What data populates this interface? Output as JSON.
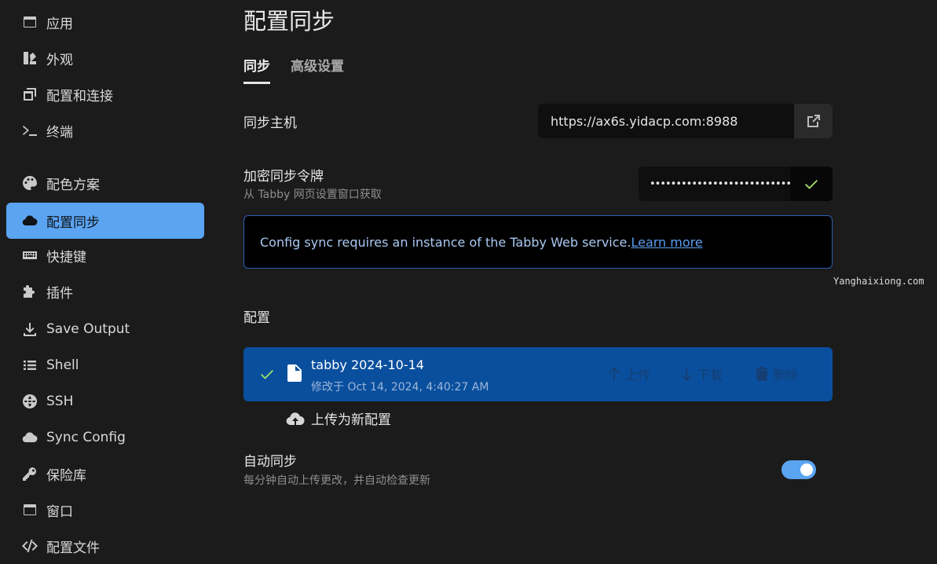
{
  "sidebar": {
    "items": [
      {
        "label": "应用",
        "icon": "window-icon"
      },
      {
        "label": "外观",
        "icon": "paint-swatch-icon"
      },
      {
        "label": "配置和连接",
        "icon": "copy-window-icon"
      },
      {
        "label": "终端",
        "icon": "terminal-icon"
      },
      {
        "label": "配色方案",
        "icon": "palette-icon"
      },
      {
        "label": "配置同步",
        "icon": "cloud-icon",
        "active": true
      },
      {
        "label": "快捷键",
        "icon": "keyboard-icon"
      },
      {
        "label": "插件",
        "icon": "puzzle-icon"
      },
      {
        "label": "Save Output",
        "icon": "download-icon"
      },
      {
        "label": "Shell",
        "icon": "list-icon"
      },
      {
        "label": "SSH",
        "icon": "globe-icon"
      },
      {
        "label": "Sync Config",
        "icon": "cloud-icon"
      },
      {
        "label": "保险库",
        "icon": "key-icon"
      },
      {
        "label": "窗口",
        "icon": "window-icon"
      },
      {
        "label": "配置文件",
        "icon": "code-icon"
      }
    ]
  },
  "page": {
    "title": "配置同步",
    "tabs": [
      {
        "label": "同步"
      },
      {
        "label": "高级设置"
      }
    ]
  },
  "host": {
    "label": "同步主机",
    "value": "https://ax6s.yidacp.com:8988"
  },
  "token": {
    "label": "加密同步令牌",
    "sublabel": "从 Tabby 网页设置窗口获取",
    "value": "••••••••••••••••••••••••••••••••••••"
  },
  "info": {
    "text": "Config sync requires an instance of the Tabby Web service.",
    "link": "Learn more"
  },
  "watermark": "Yanghaixiong.com",
  "configs": {
    "label": "配置",
    "item": {
      "name": "tabby 2024-10-14",
      "modified": "修改于 Oct 14, 2024, 4:40:27 AM",
      "upload": "上传",
      "download": "下载",
      "delete": "删除"
    },
    "upload_new": "上传为新配置"
  },
  "auto_sync": {
    "label": "自动同步",
    "sublabel": "每分钟自动上传更改，并自动检查更新",
    "enabled": true
  },
  "colors": {
    "accent": "#5aa4f2",
    "config_row": "#0a4f9e",
    "check": "#a6e36b"
  }
}
